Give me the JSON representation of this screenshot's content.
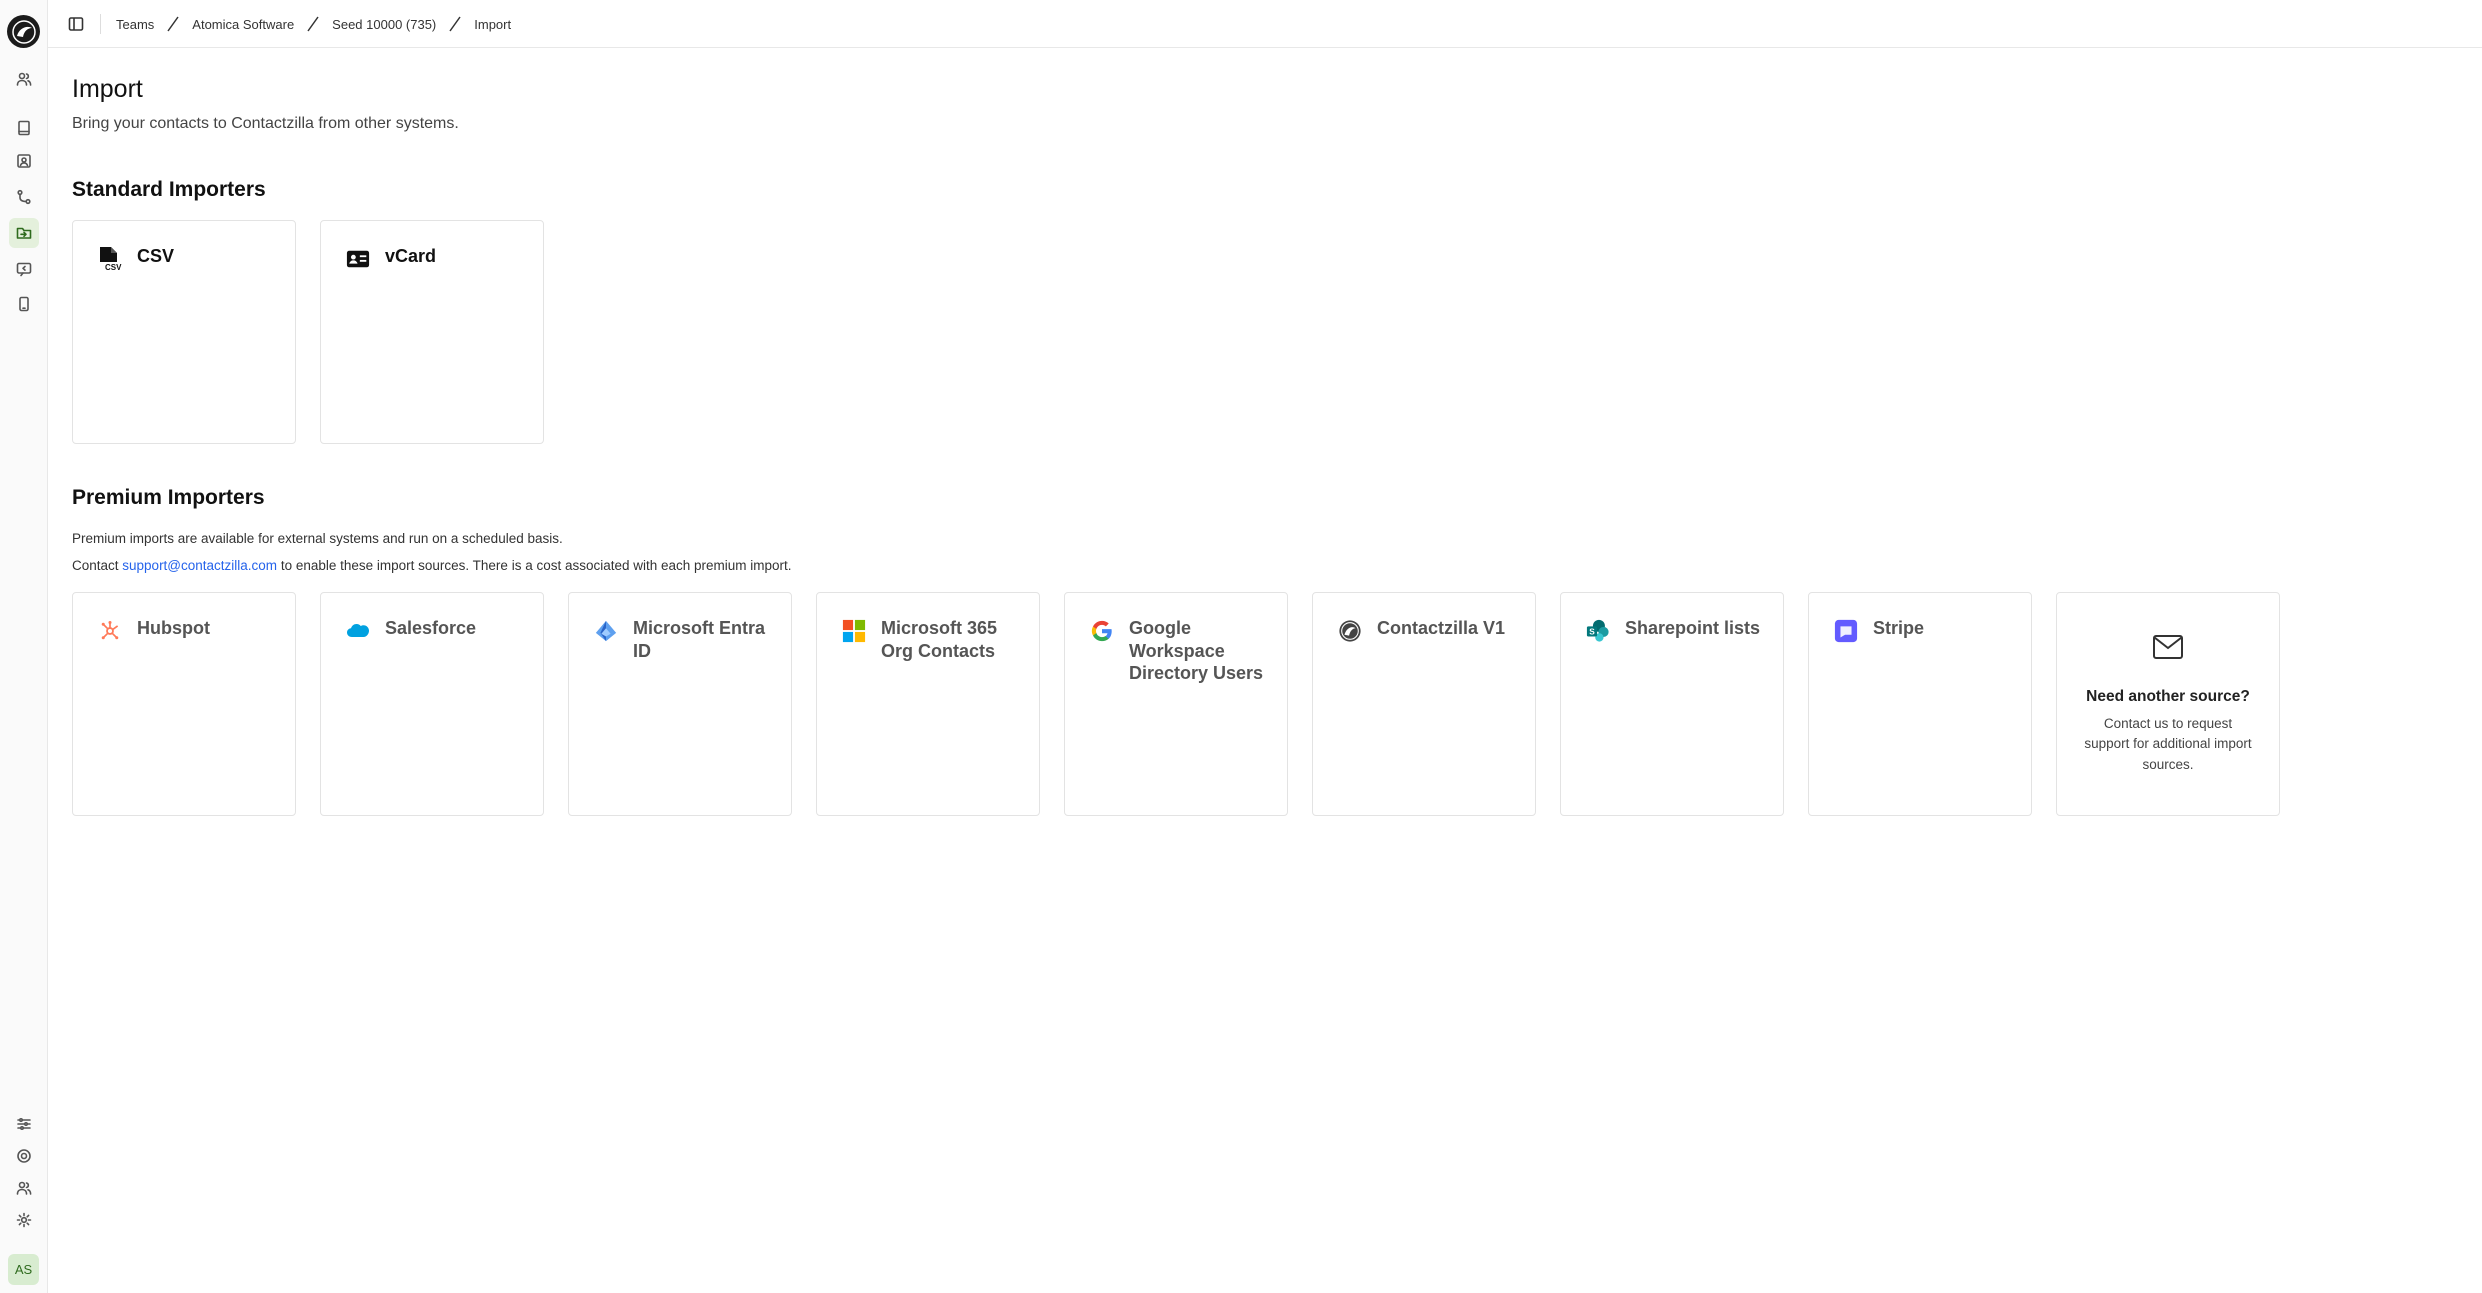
{
  "sidebar": {
    "icons": [
      "users-icon",
      "book-icon",
      "contact-card-icon",
      "git-branch-icon",
      "folder-import-icon",
      "message-icon",
      "phone-icon",
      "sliders-icon",
      "target-icon",
      "team-icon",
      "settings-icon"
    ],
    "avatar_initials": "AS"
  },
  "breadcrumb": [
    "Teams",
    "Atomica Software",
    "Seed 10000 (735)",
    "Import"
  ],
  "page": {
    "title": "Import",
    "subtitle": "Bring your contacts to Contactzilla from other systems."
  },
  "standard": {
    "title": "Standard Importers",
    "items": [
      {
        "label": "CSV",
        "icon": "csv-file-icon"
      },
      {
        "label": "vCard",
        "icon": "vcard-icon"
      }
    ]
  },
  "premium": {
    "title": "Premium Importers",
    "note1": "Premium imports are available for external systems and run on a scheduled basis.",
    "note2_prefix": "Contact ",
    "note2_link": "support@contactzilla.com",
    "note2_suffix": " to enable these import sources. There is a cost associated with each premium import.",
    "items": [
      {
        "label": "Hubspot",
        "icon": "hubspot-icon"
      },
      {
        "label": "Salesforce",
        "icon": "salesforce-icon"
      },
      {
        "label": "Microsoft Entra ID",
        "icon": "entra-icon"
      },
      {
        "label": "Microsoft 365 Org Contacts",
        "icon": "microsoft-icon"
      },
      {
        "label": "Google Workspace Directory Users",
        "icon": "google-icon"
      },
      {
        "label": "Contactzilla V1",
        "icon": "contactzilla-icon"
      },
      {
        "label": "Sharepoint lists",
        "icon": "sharepoint-icon"
      },
      {
        "label": "Stripe",
        "icon": "stripe-icon"
      }
    ],
    "other": {
      "title": "Need another source?",
      "desc": "Contact us to request support for additional import sources."
    }
  },
  "colors": {
    "accent_green": "#2f6b1e",
    "active_bg": "#e4f0dc",
    "link": "#2563eb",
    "hubspot": "#ff7a59",
    "salesforce": "#00a1e0",
    "stripe": "#635bff"
  }
}
